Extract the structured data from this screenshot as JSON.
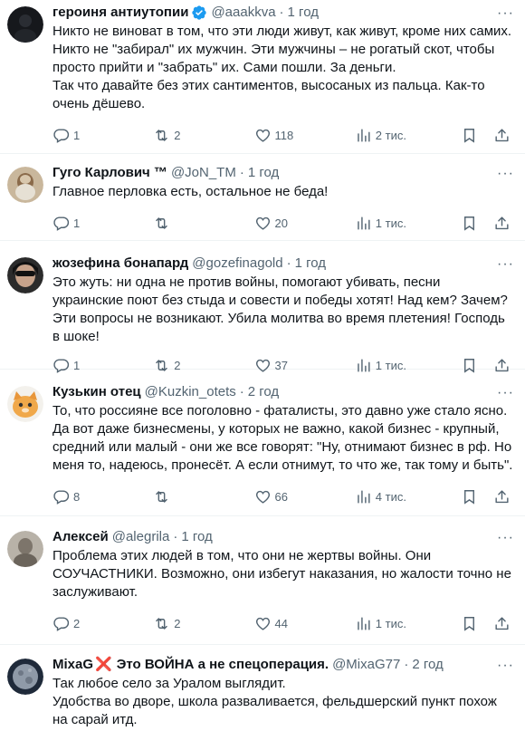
{
  "tweets": [
    {
      "name": "героиня антиутопии",
      "verified": true,
      "handle": "@aaakkva",
      "time": "1 год",
      "text": "Никто не виноват в том, что эти люди живут, как живут, кроме них самих.\nНикто не \"забирал\" их мужчин. Эти мужчины – не рогатый скот, чтобы просто прийти и \"забрать\" их. Сами пошли. За деньги.\nТак что давайте без этих сантиментов, высосаных из пальца. Как-то очень дёшево.",
      "replies": "1",
      "reposts": "2",
      "likes": "118",
      "views": "2 тис."
    },
    {
      "name": "Гуго Карлович ™",
      "handle": "@JoN_TM",
      "time": "1 год",
      "text": "Главное перловка есть, остальное не беда!",
      "replies": "1",
      "reposts": "",
      "likes": "20",
      "views": "1 тис."
    },
    {
      "name": "жозефина бонапард",
      "handle": "@gozefinagold",
      "time": "1 год",
      "text": "Это жуть: ни одна не против войны, помогают убивать, песни украинские поют без стыда и совести и победы хотят! Над кем? Зачем? Эти вопросы не возникают. Убила молитва во время плетения! Господь в шоке!",
      "replies": "1",
      "reposts": "2",
      "likes": "37",
      "views": "1 тис."
    },
    {
      "name": "Кузькин отец",
      "handle": "@Kuzkin_otets",
      "time": "2 год",
      "text": "То, что россияне все поголовно - фаталисты, это давно уже стало ясно. Да вот даже бизнесмены, у которых не важно, какой бизнес - крупный, средний или малый - они же все говорят: \"Ну, отнимают бизнес в рф. Но меня то, надеюсь, пронесёт. А если отнимут, то что же, так тому и быть\".",
      "replies": "8",
      "reposts": "",
      "likes": "66",
      "views": "4 тис."
    },
    {
      "name": "Алексей",
      "handle": "@alegrila",
      "time": "1 год",
      "text": "Проблема этих людей в том, что они не жертвы войны. Они СОУЧАСТНИКИ. Возможно, они избегут наказания, но жалости точно не заслуживают.",
      "replies": "2",
      "reposts": "2",
      "likes": "44",
      "views": "1 тис."
    },
    {
      "name": "MixaG",
      "name_emoji": "❌",
      "name_suffix": "Это ВОЙНА а не спецоперация.",
      "handle": "@MixaG77",
      "time": "2 год",
      "text": "Так любое село за Уралом выглядит.\nУдобства во дворе, школа разваливается, фельдшерский пункт похож на сарай итд."
    }
  ],
  "ui": {
    "separator": "·",
    "more": "···",
    "icons": [
      "more-icon",
      "reply-icon",
      "repost-icon",
      "like-icon",
      "views-icon",
      "bookmark-icon",
      "share-icon",
      "verified-badge-icon"
    ],
    "accent": "#1d9bf0",
    "muted": "#536471"
  }
}
